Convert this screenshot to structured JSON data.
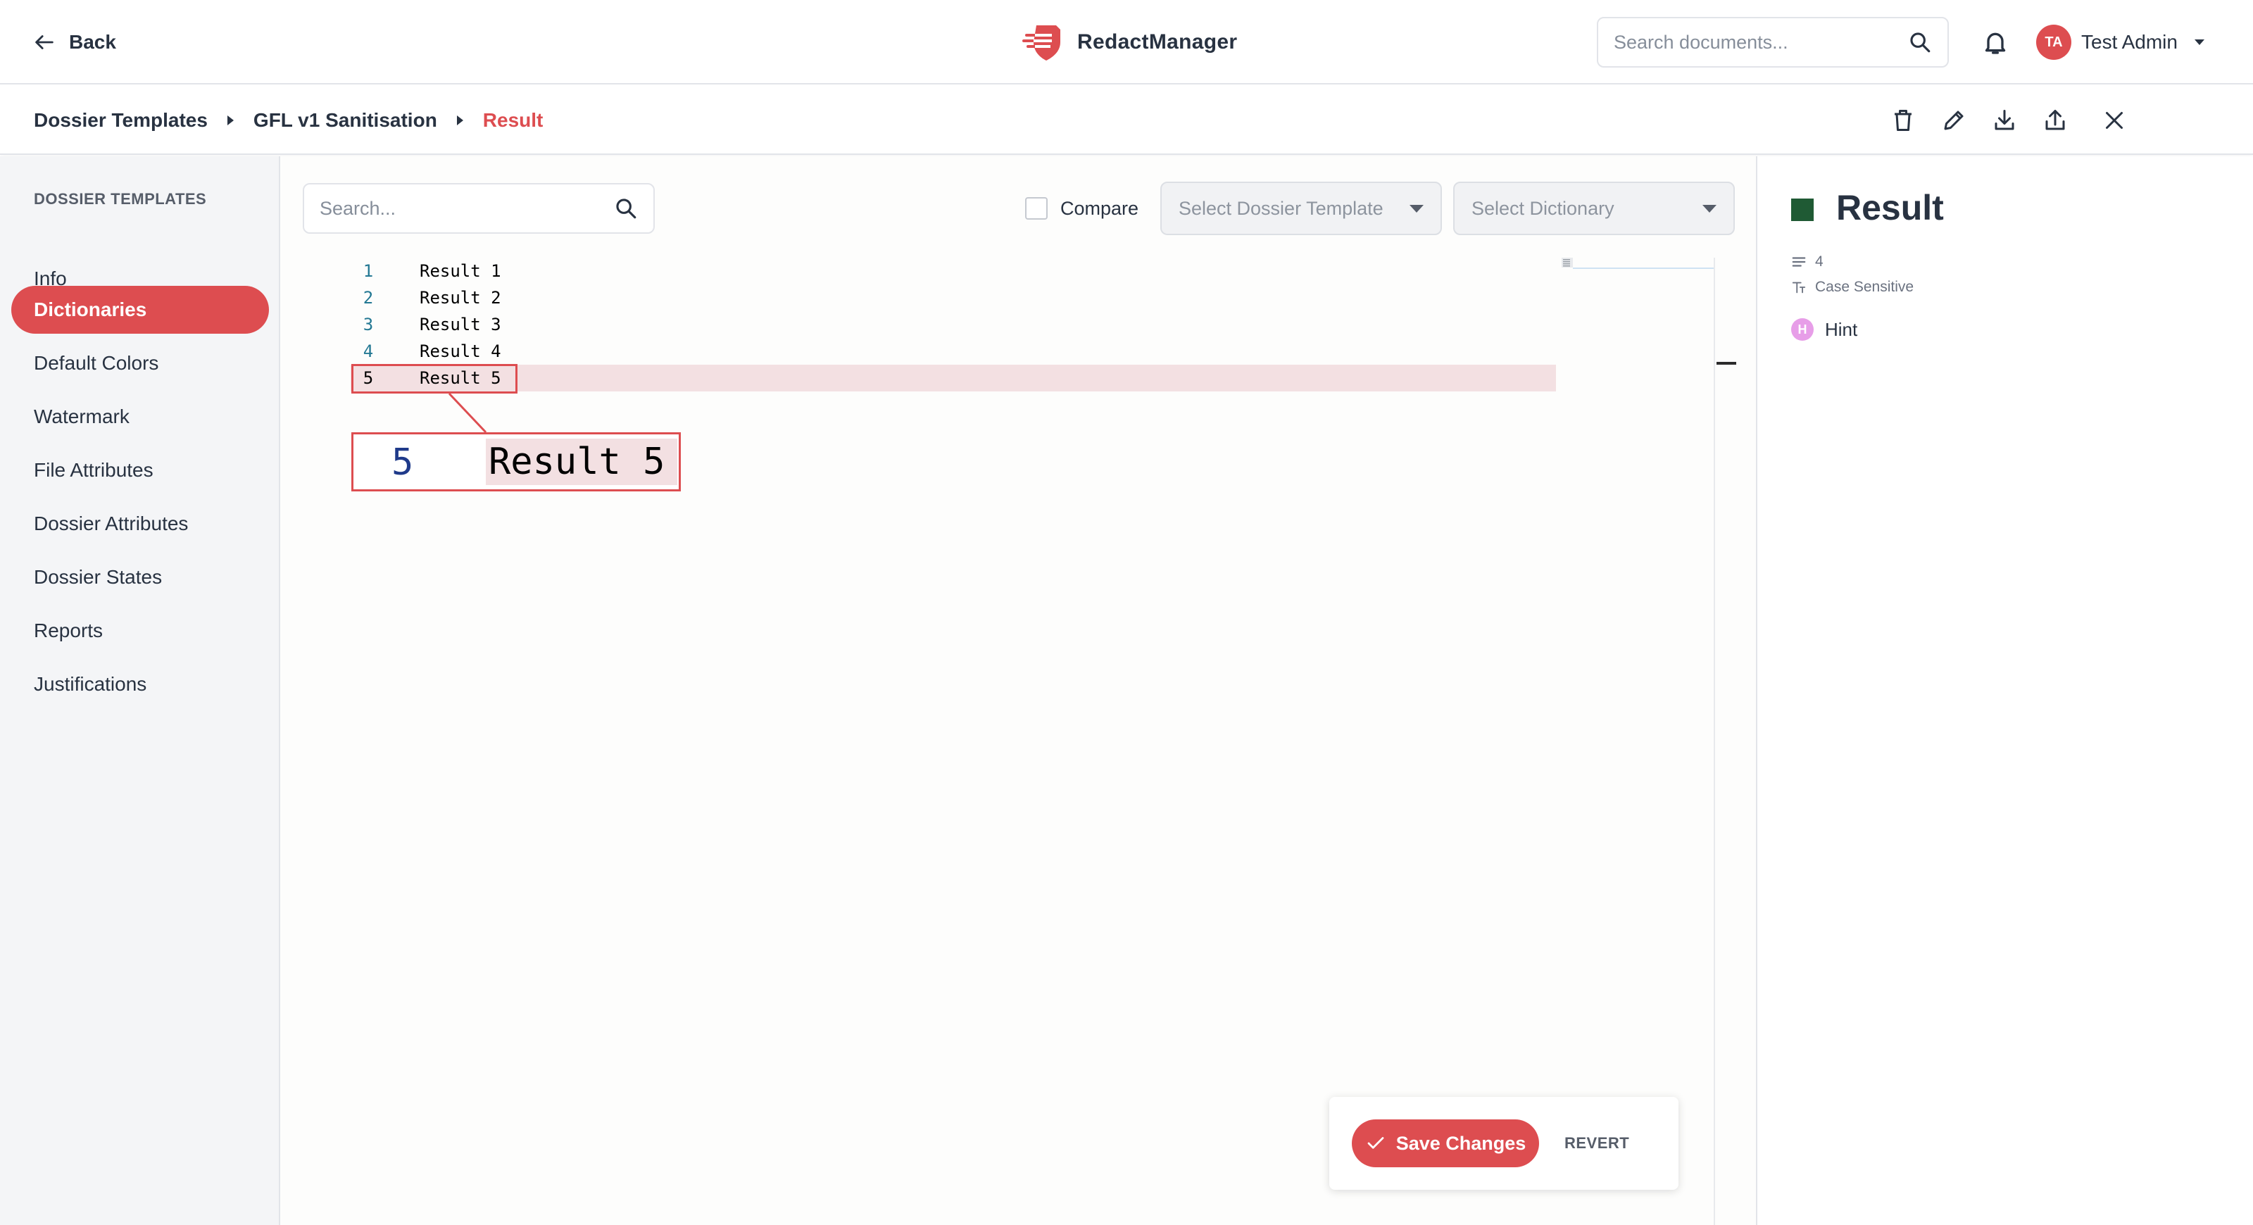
{
  "header": {
    "back_label": "Back",
    "brand_name": "RedactManager",
    "search_placeholder": "Search documents...",
    "user_initials": "TA",
    "user_name": "Test Admin"
  },
  "breadcrumb": [
    "Dossier Templates",
    "GFL v1 Sanitisation",
    "Result"
  ],
  "sidebar": {
    "title": "DOSSIER TEMPLATES",
    "items": [
      {
        "label": "Info",
        "active": false
      },
      {
        "label": "Dictionaries",
        "active": true
      },
      {
        "label": "Default Colors",
        "active": false
      },
      {
        "label": "Watermark",
        "active": false
      },
      {
        "label": "File Attributes",
        "active": false
      },
      {
        "label": "Dossier Attributes",
        "active": false
      },
      {
        "label": "Dossier States",
        "active": false
      },
      {
        "label": "Reports",
        "active": false
      },
      {
        "label": "Justifications",
        "active": false
      }
    ]
  },
  "editor": {
    "search_placeholder": "Search...",
    "compare_label": "Compare",
    "compare_checked": false,
    "template_select_placeholder": "Select Dossier Template",
    "dictionary_select_placeholder": "Select Dictionary",
    "lines": [
      {
        "number": "1",
        "text": "Result 1"
      },
      {
        "number": "2",
        "text": "Result 2"
      },
      {
        "number": "3",
        "text": "Result 3"
      },
      {
        "number": "4",
        "text": "Result 4"
      },
      {
        "number": "5",
        "text": "Result 5"
      }
    ],
    "highlighted_line": "5",
    "zoom": {
      "number": "5",
      "text": "Result 5"
    },
    "save_label": "Save Changes",
    "revert_label": "REVERT"
  },
  "details": {
    "title": "Result",
    "swatch_color": "#1f5a34",
    "entry_count": "4",
    "case_label": "Case Sensitive",
    "type_badge": "H",
    "type_label": "Hint"
  },
  "colors": {
    "accent": "#dd4d50",
    "hint": "#e79ee8",
    "line_highlight": "#f3e0e2"
  }
}
